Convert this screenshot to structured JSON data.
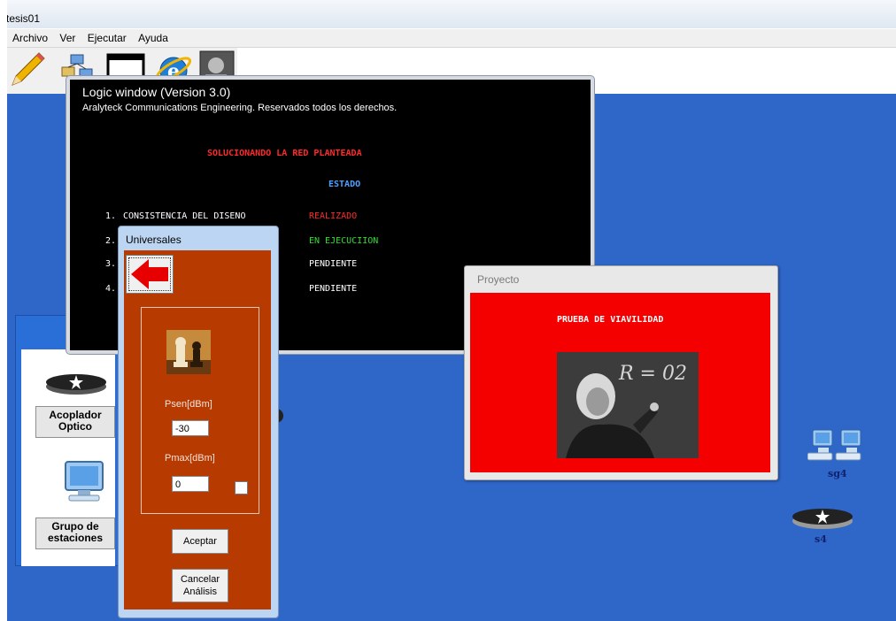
{
  "app": {
    "title": "tesis01"
  },
  "menu": [
    "Archivo",
    "Ver",
    "Ejecutar",
    "Ayuda"
  ],
  "toolbar_icons": [
    "pencil-icon",
    "network-icon",
    "window-icon",
    "internet-explorer-icon",
    "photo-icon"
  ],
  "logic": {
    "title": "Logic window (Version 3.0)",
    "subtitle": "Aralyteck Communications Engineering.  Reservados todos los derechos.",
    "heading": "SOLUCIONANDO LA RED PLANTEADA",
    "estado": "ESTADO",
    "steps": [
      {
        "num": "1.",
        "label": "CONSISTENCIA DEL DISENO",
        "status": "REALIZADO",
        "color": "#ff2a2a"
      },
      {
        "num": "2.",
        "label": "",
        "status": "EN EJECUCIION",
        "color": "#33dd33"
      },
      {
        "num": "3.",
        "label": "",
        "status": "PENDIENTE",
        "color": "#ffffff"
      },
      {
        "num": "4.",
        "label": "",
        "status": "PENDIENTE",
        "color": "#ffffff"
      }
    ]
  },
  "universales": {
    "title": "Universales",
    "psen_label": "Psen[dBm]",
    "psen_value": "-30",
    "pmax_label": "Pmax[dBm]",
    "pmax_value": "0",
    "accept": "Aceptar",
    "cancel_line1": "Cancelar",
    "cancel_line2": "Análisis"
  },
  "palette": {
    "item1_line1": "Acoplador",
    "item1_line2": "Optico",
    "item2_line1": "Grupo de",
    "item2_line2": "estaciones"
  },
  "proyecto": {
    "title": "Proyecto",
    "heading": "PRUEBA DE VIAVILIDAD",
    "board_text": "R = 02"
  },
  "nodes": {
    "sg4": "sg4",
    "s4": "s4"
  },
  "colors": {
    "desktop": "#2f67c9",
    "panel": "#b73a00",
    "proyecto": "#f50000"
  }
}
